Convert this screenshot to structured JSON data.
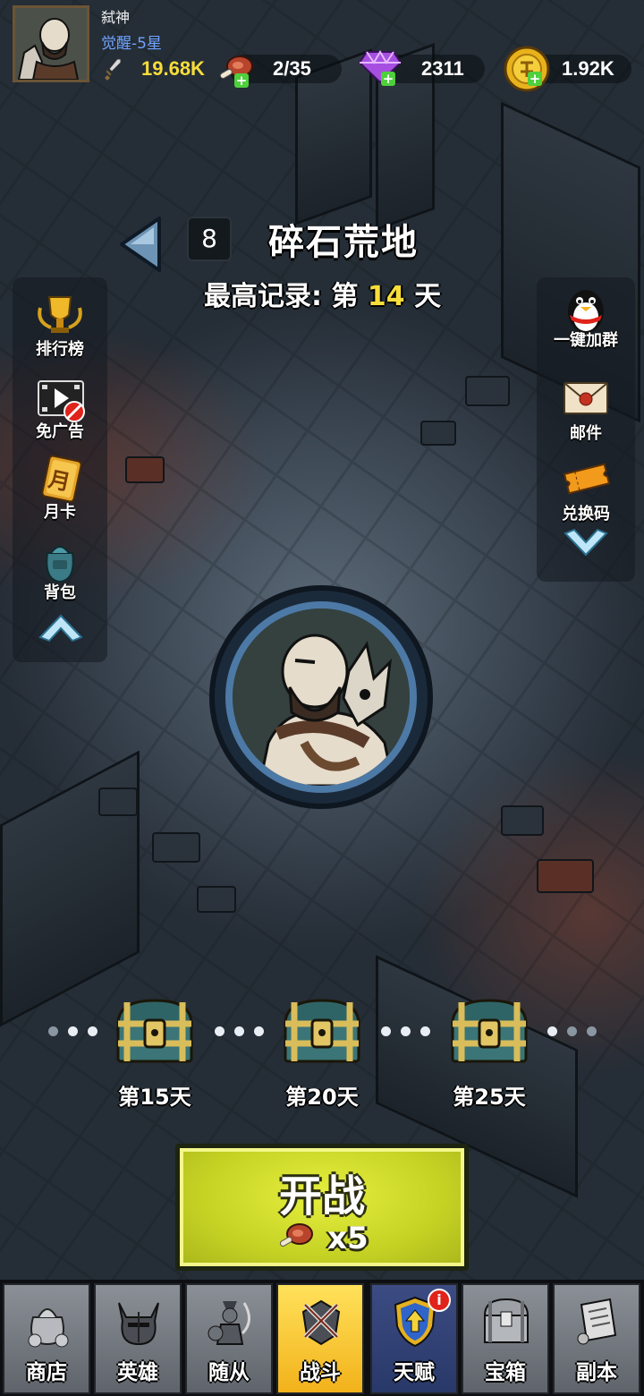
{
  "player": {
    "name": "弑神",
    "awakening": "觉醒-5星"
  },
  "resources": {
    "power": "19.68K",
    "stamina": "2/35",
    "gems": "2311",
    "gold": "1.92K"
  },
  "stage": {
    "number": "8",
    "name": "碎石荒地",
    "record_prefix": "最高记录: 第",
    "record_day": "14",
    "record_suffix": "天"
  },
  "left_menu": [
    {
      "label": "排行榜",
      "icon": "trophy-icon"
    },
    {
      "label": "免广告",
      "icon": "no-ads-icon"
    },
    {
      "label": "月卡",
      "icon": "monthly-card-icon"
    },
    {
      "label": "背包",
      "icon": "backpack-icon"
    }
  ],
  "right_menu": [
    {
      "label": "一键加群",
      "icon": "penguin-icon"
    },
    {
      "label": "邮件",
      "icon": "mail-icon"
    },
    {
      "label": "兑换码",
      "icon": "ticket-icon"
    }
  ],
  "month_card_char": "月",
  "milestones": [
    {
      "label": "第15天"
    },
    {
      "label": "第20天"
    },
    {
      "label": "第25天"
    }
  ],
  "start_button": {
    "label": "开战",
    "cost": "x5"
  },
  "nav": {
    "tabs": [
      {
        "label": "商店",
        "icon": "money-bag-icon"
      },
      {
        "label": "英雄",
        "icon": "helmet-icon"
      },
      {
        "label": "随从",
        "icon": "follower-icon"
      },
      {
        "label": "战斗",
        "icon": "crossed-swords-icon",
        "active": true
      },
      {
        "label": "天赋",
        "icon": "shield-arrow-icon",
        "badge": "i"
      },
      {
        "label": "宝箱",
        "icon": "chest-icon"
      },
      {
        "label": "副本",
        "icon": "scroll-icon"
      }
    ]
  },
  "colors": {
    "accent_yellow": "#f7dd3a",
    "awakening_blue": "#6fa3ff",
    "start_green": "#c5d224",
    "active_tab": "#f2b21b"
  }
}
